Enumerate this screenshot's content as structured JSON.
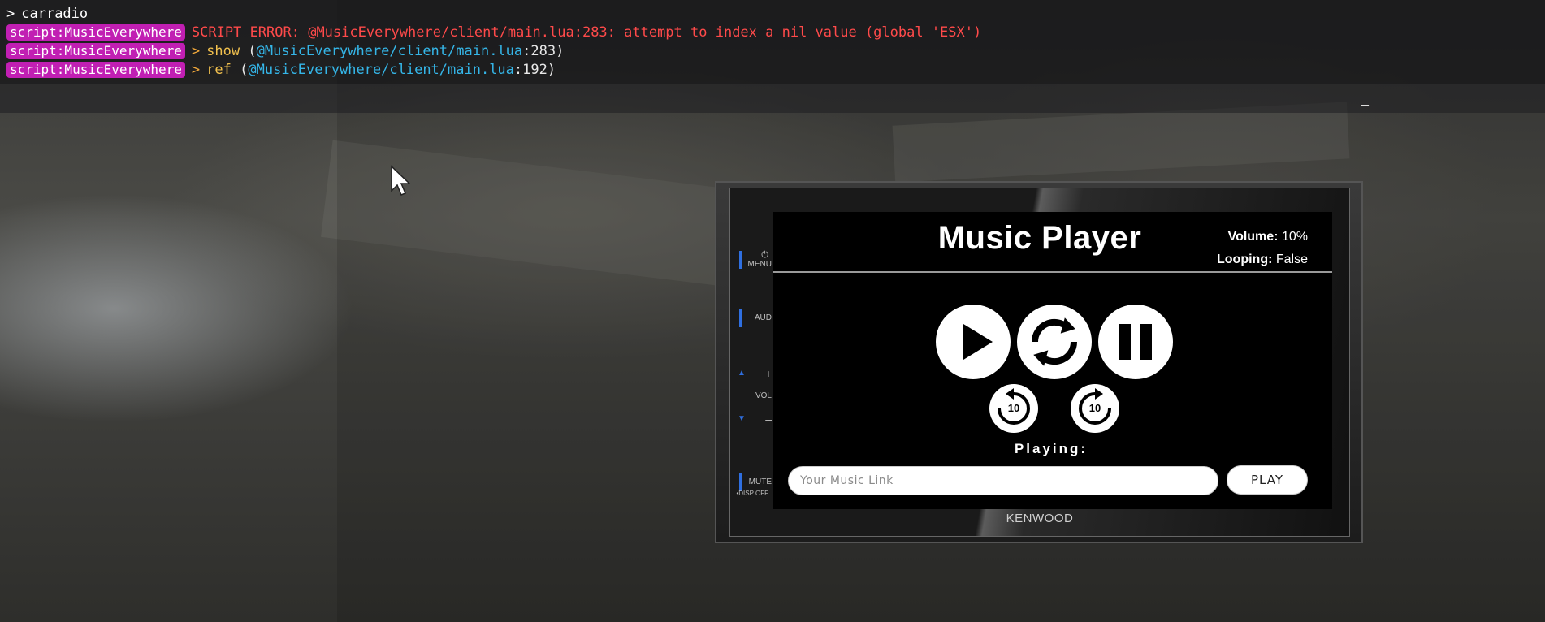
{
  "console": {
    "prompt_caret": ">",
    "command": "carradio",
    "lines": [
      {
        "tag": "script:MusicEverywhere",
        "text": "SCRIPT ERROR: @MusicEverywhere/client/main.lua:283: attempt to index a nil value (global 'ESX')"
      },
      {
        "tag": "script:MusicEverywhere",
        "gt": ">",
        "fn": "show",
        "open": "(",
        "path": "@MusicEverywhere/client/main.lua",
        "lineno": ":283)"
      },
      {
        "tag": "script:MusicEverywhere",
        "gt": ">",
        "fn": "ref",
        "open": "(",
        "path": "@MusicEverywhere/client/main.lua",
        "lineno": ":192)"
      }
    ],
    "minimize_label": "_"
  },
  "radio": {
    "side_labels": {
      "menu": "MENU",
      "aud": "AUD",
      "vol_plus": "+",
      "vol": "VOL",
      "vol_minus": "–",
      "mute": "MUTE",
      "disp_off": "•DISP OFF"
    },
    "brand": "KENWOOD"
  },
  "player": {
    "title": "Music Player",
    "volume_label": "Volume:",
    "volume_value": "10%",
    "looping_label": "Looping:",
    "looping_value": "False",
    "rewind_value": "10",
    "forward_value": "10",
    "playing_label": "Playing:",
    "link_placeholder": "Your Music Link",
    "play_button": "PLAY"
  },
  "icons": [
    "play-icon",
    "loop-icon",
    "pause-icon",
    "rewind-10-icon",
    "forward-10-icon",
    "power-icon",
    "mouse-cursor-icon"
  ],
  "colors": {
    "error_red": "#ff4a4a",
    "tag_magenta": "#c11fb3",
    "path_blue": "#35b6e8",
    "fn_yellow": "#f2c14e",
    "side_accent_blue": "#2f6fe0"
  }
}
